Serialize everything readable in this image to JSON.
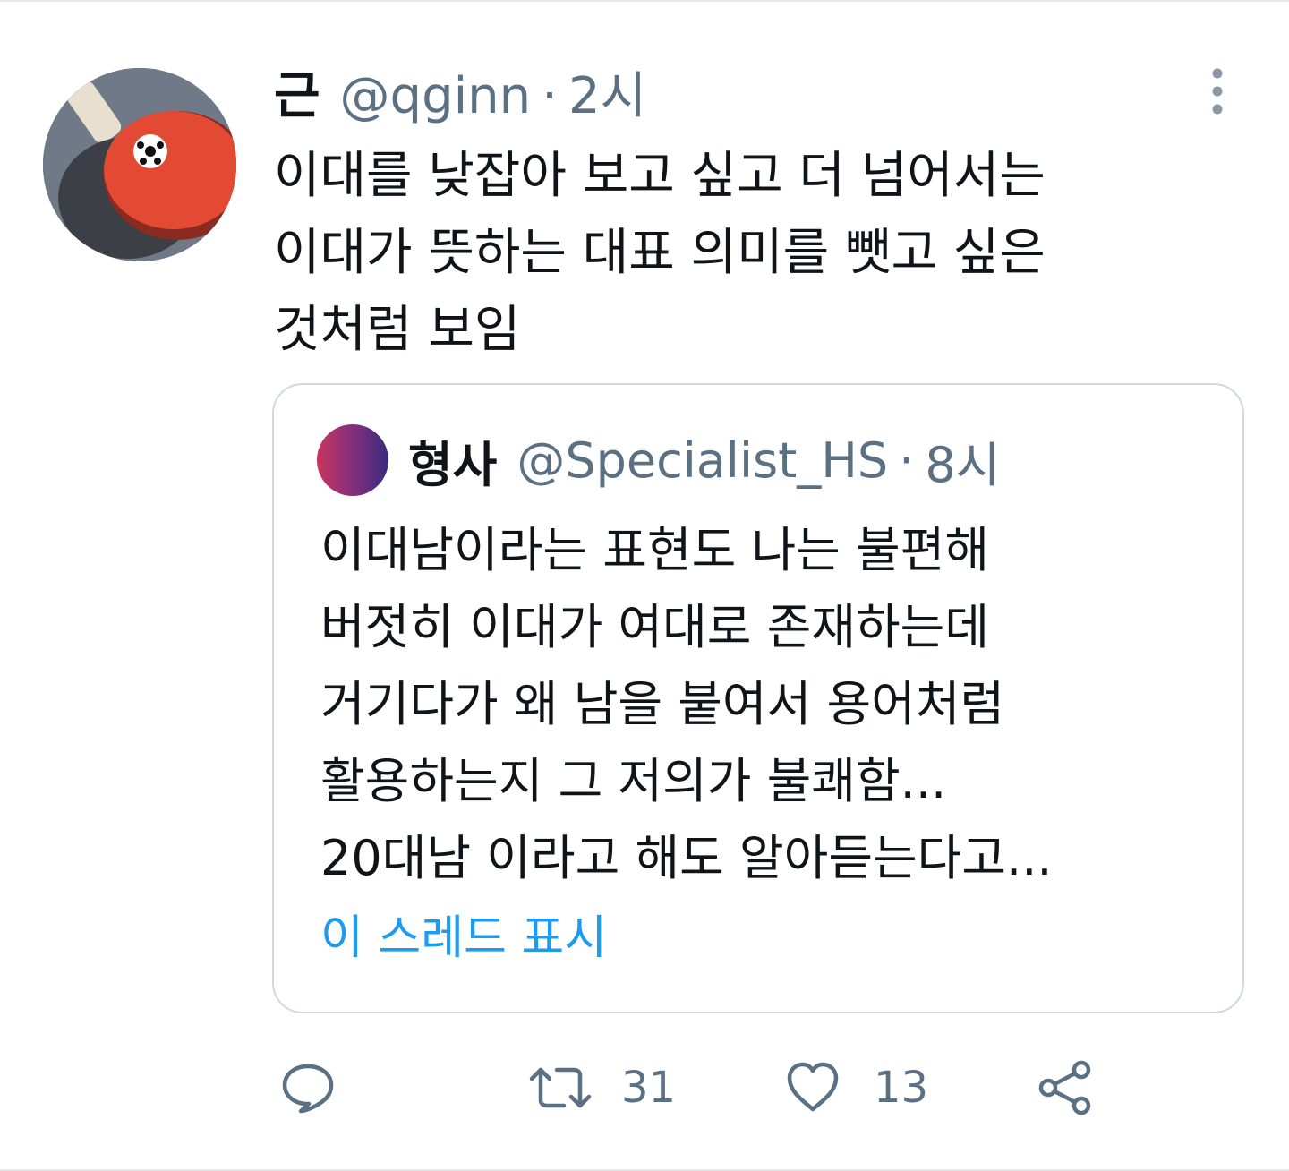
{
  "tweet": {
    "display_name": "근",
    "handle": "@qginn",
    "separator": "·",
    "time": "2시",
    "text_lines": [
      "이대를 낮잡아 보고 싶고 더 넘어서는",
      "이대가 뜻하는 대표 의미를 뺏고 싶은",
      "것처럼 보임"
    ],
    "avatar_icon": "ping-pong-paddle-avatar",
    "more_icon": "more-vertical-icon"
  },
  "quote": {
    "display_name": "형사",
    "handle": "@Specialist_HS",
    "separator": "·",
    "time": "8시",
    "text_lines": [
      "이대남이라는 표현도 나는 불편해",
      "버젓히 이대가 여대로 존재하는데",
      "거기다가 왜 남을 붙여서 용어처럼",
      "활용하는지 그 저의가 불쾌함...",
      "20대남 이라고 해도 알아듣는다고..."
    ],
    "show_thread": "이 스레드 표시",
    "avatar_gradient": [
      "#c8365d",
      "#3a2b7f"
    ]
  },
  "actions": {
    "reply_icon": "reply-icon",
    "retweet_icon": "retweet-icon",
    "retweet_count": "31",
    "like_icon": "heart-icon",
    "like_count": "13",
    "share_icon": "share-icon"
  },
  "colors": {
    "text_primary": "#0f1419",
    "text_secondary": "#5b7083",
    "link": "#1d9bf0",
    "border": "#cfd9de"
  }
}
